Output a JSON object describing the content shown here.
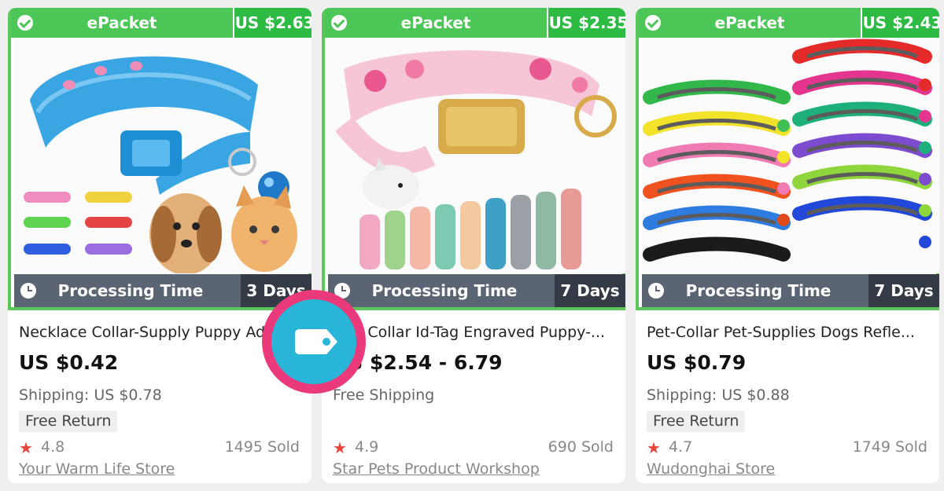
{
  "products": [
    {
      "shipping_method": "ePacket",
      "ship_price": "US $2.63",
      "processing_label": "Processing Time",
      "processing_days": "3 Days",
      "title": "Necklace Collar-Supply Puppy Adju...",
      "price": "US $0.42",
      "shipping": "Shipping: US $0.78",
      "free_return": "Free Return",
      "rating": "4.8",
      "sold": "1495 Sold",
      "store": "Your Warm Life Store"
    },
    {
      "shipping_method": "ePacket",
      "ship_price": "US $2.35",
      "processing_label": "Processing Time",
      "processing_days": "7 Days",
      "title": "Dog Collar Id-Tag Engraved Puppy-...",
      "price": "US $2.54 - 6.79",
      "shipping": "Free Shipping",
      "rating": "4.9",
      "sold": "690 Sold",
      "store": "Star Pets Product Workshop"
    },
    {
      "shipping_method": "ePacket",
      "ship_price": "US $2.43",
      "processing_label": "Processing Time",
      "processing_days": "7 Days",
      "title": "Pet-Collar Pet-Supplies Dogs Refle...",
      "price": "US $0.79",
      "shipping": "Shipping: US $0.88",
      "free_return": "Free Return",
      "rating": "4.7",
      "sold": "1749 Sold",
      "store": "Wudonghai Store"
    }
  ],
  "icons": {
    "check": "check-circle-icon",
    "clock": "clock-icon",
    "star": "star-icon",
    "tag": "price-tag-icon"
  },
  "colors": {
    "green_bar": "#4bc657",
    "green_price": "#2dbb43",
    "processing_bar": "#5a6472",
    "days_box": "#343b46",
    "star": "#e8453c",
    "badge_ring": "#ea3a7b",
    "badge_fill": "#29b5d8"
  }
}
